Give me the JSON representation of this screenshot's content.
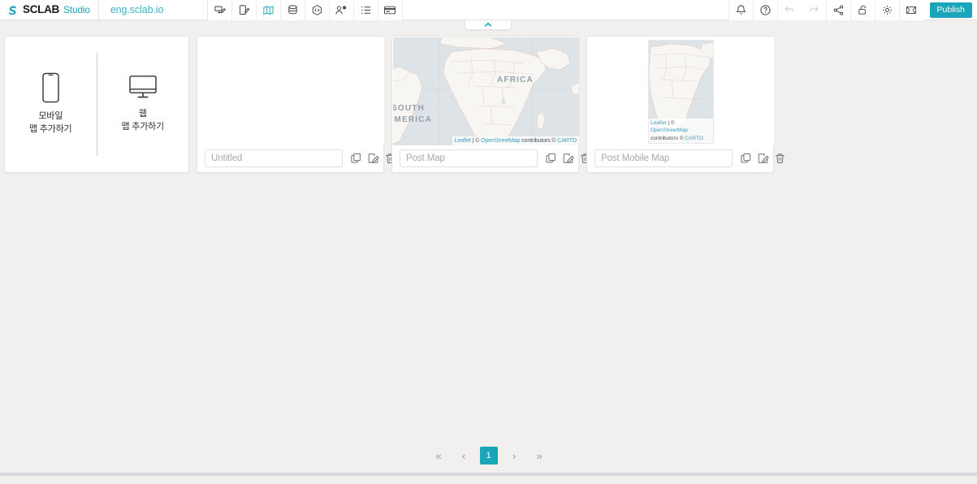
{
  "app": {
    "brand_main": "SCLAB",
    "brand_sub": "Studio",
    "site_name": "eng.sclab.io",
    "accent_color": "#1ba5b8",
    "background_color": "#f1f0ee"
  },
  "toolbar": {
    "left_tools": [
      {
        "name": "web-edit-icon",
        "label": "Web Editor"
      },
      {
        "name": "mobile-edit-icon",
        "label": "Mobile Editor"
      },
      {
        "name": "map-icon",
        "label": "Map",
        "active": true
      },
      {
        "name": "database-icon",
        "label": "Data"
      },
      {
        "name": "code-icon",
        "label": "API"
      },
      {
        "name": "users-icon",
        "label": "Members"
      },
      {
        "name": "list-icon",
        "label": "List"
      },
      {
        "name": "card-icon",
        "label": "Card"
      }
    ],
    "right_tools": [
      {
        "name": "bell-icon",
        "label": "Notifications"
      },
      {
        "name": "help-icon",
        "label": "Help"
      },
      {
        "name": "undo-icon",
        "label": "Undo"
      },
      {
        "name": "redo-icon",
        "label": "Redo"
      },
      {
        "name": "share-icon",
        "label": "Share"
      },
      {
        "name": "unlock-icon",
        "label": "Unlock"
      },
      {
        "name": "gear-icon",
        "label": "Settings"
      },
      {
        "name": "fullscreen-icon",
        "label": "Fullscreen"
      }
    ],
    "publish_label": "Publish"
  },
  "collapse_tab": {
    "icon": "chevron-up-icon"
  },
  "add_card": {
    "mobile": {
      "icon": "mobile-phone-icon",
      "line1": "모바일",
      "line2": "맵 추가하기"
    },
    "web": {
      "icon": "desktop-monitor-icon",
      "line1": "웹",
      "line2": "맵 추가하기"
    }
  },
  "cards": [
    {
      "type": "blank",
      "title": "",
      "title_placeholder": "Untitled",
      "actions": [
        "copy-icon",
        "edit-icon",
        "delete-icon"
      ]
    },
    {
      "type": "web-map",
      "title": "Post Map",
      "title_placeholder": "Post Map",
      "actions": [
        "copy-icon",
        "edit-icon",
        "delete-icon"
      ],
      "map_labels": [
        "AFRICA",
        "SOUTH",
        "AMERICA"
      ],
      "attribution": {
        "leaflet": "Leaflet",
        "sep": " | © ",
        "osm": "OpenStreetMap",
        "mid": " contributors © ",
        "carto": "CARTO"
      }
    },
    {
      "type": "mobile-map",
      "title": "Post Mobile Map",
      "title_placeholder": "Post Mobile Map",
      "actions": [
        "copy-icon",
        "edit-icon",
        "delete-icon"
      ],
      "attribution": {
        "leaflet": "Leaflet",
        "sep": " | © ",
        "osm": "OpenStreetMap",
        "mid": " contributors © ",
        "carto": "CARTO"
      }
    }
  ],
  "pagination": {
    "first": "«",
    "prev": "‹",
    "pages": [
      "1"
    ],
    "next": "›",
    "last": "»",
    "current": "1"
  }
}
